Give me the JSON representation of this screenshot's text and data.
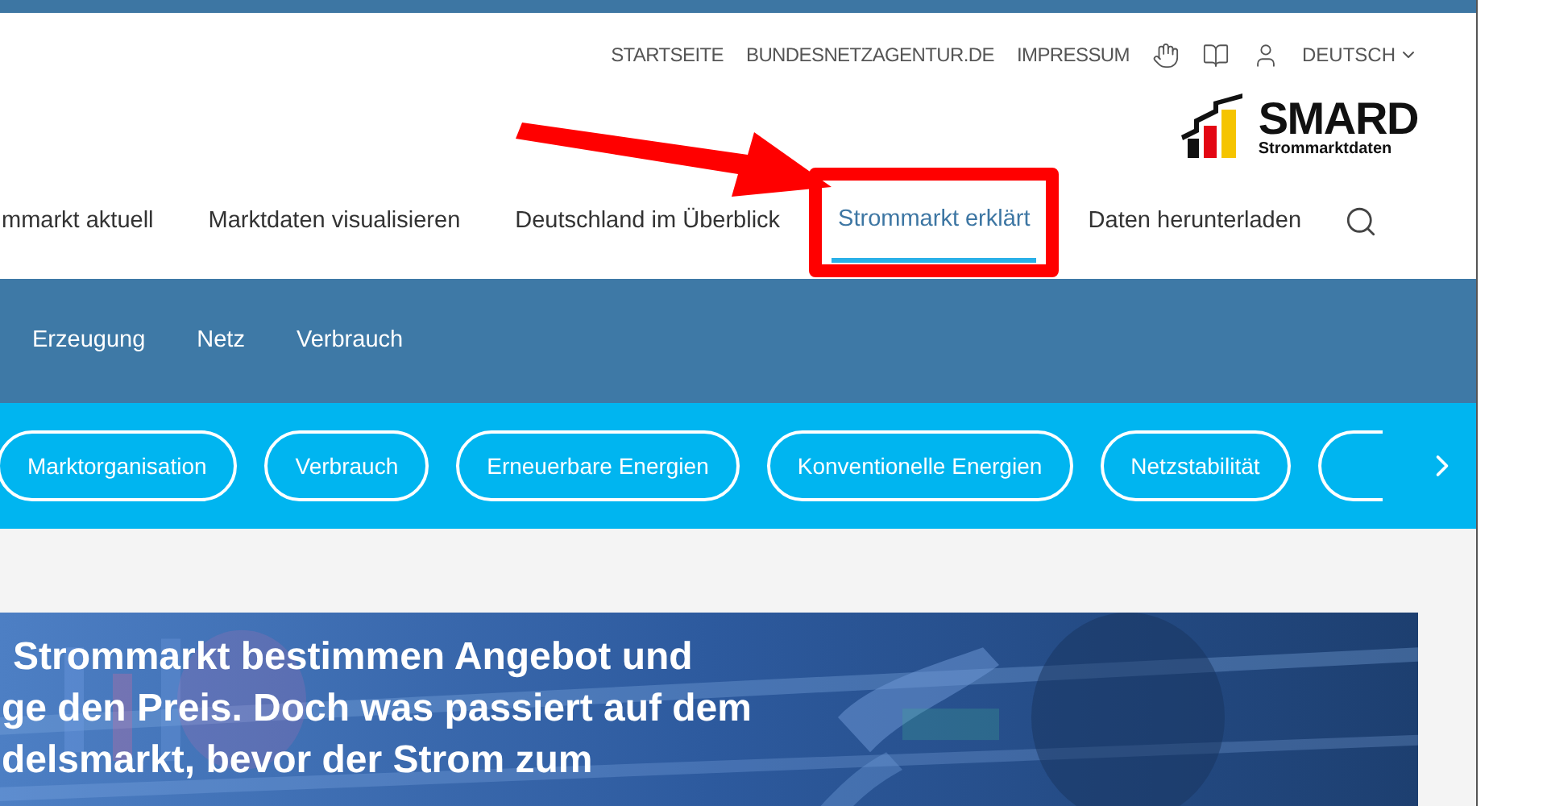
{
  "top_links": [
    "STARTSEITE",
    "BUNDESNETZAGENTUR.DE",
    "IMPRESSUM"
  ],
  "language": "DEUTSCH",
  "logo": {
    "title": "SMARD",
    "subtitle": "Strommarktdaten"
  },
  "main_nav": [
    {
      "label": "mmarkt aktuell",
      "selected": false
    },
    {
      "label": "Marktdaten visualisieren",
      "selected": false
    },
    {
      "label": "Deutschland im Überblick",
      "selected": false
    },
    {
      "label": "Strommarkt erklärt",
      "selected": true
    },
    {
      "label": "Daten herunterladen",
      "selected": false
    }
  ],
  "sub_nav": [
    "Erzeugung",
    "Netz",
    "Verbrauch"
  ],
  "topic_pills": [
    "Marktorganisation",
    "Verbrauch",
    "Erneuerbare Energien",
    "Konventionelle Energien",
    "Netzstabilität"
  ],
  "hero": {
    "kind": "picture",
    "lines": [
      "Strommarkt bestimmen Angebot und",
      "ge den Preis. Doch was passiert auf dem",
      "delsmarkt, bevor der Strom zum"
    ]
  }
}
